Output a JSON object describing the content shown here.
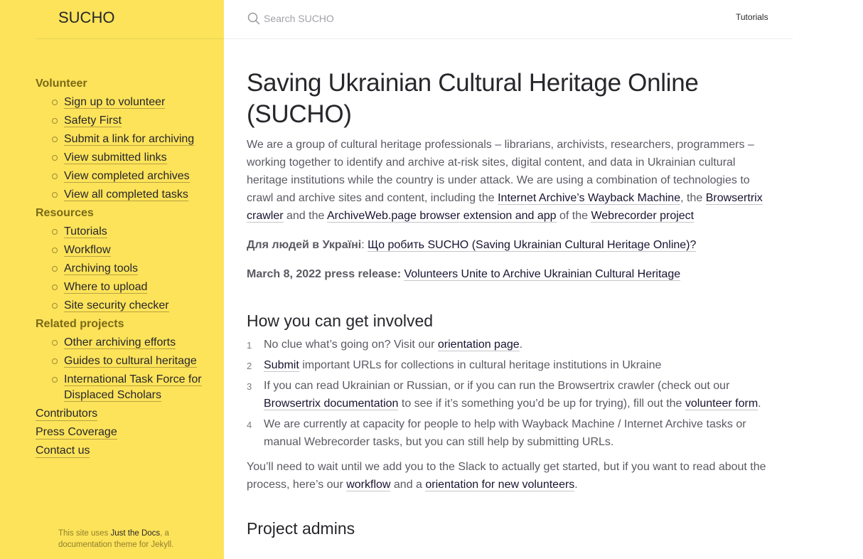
{
  "site": {
    "title": "SUCHO"
  },
  "search": {
    "placeholder": "Search SUCHO"
  },
  "topbar": {
    "link": "Tutorials"
  },
  "nav": {
    "volunteer": {
      "label": "Volunteer",
      "items": [
        "Sign up to volunteer",
        "Safety First",
        "Submit a link for archiving",
        "View submitted links",
        "View completed archives",
        "View all completed tasks"
      ]
    },
    "resources": {
      "label": "Resources",
      "items": [
        "Tutorials",
        "Workflow",
        "Archiving tools",
        "Where to upload",
        "Site security checker"
      ]
    },
    "related": {
      "label": "Related projects",
      "items": [
        "Other archiving efforts",
        "Guides to cultural heritage",
        "International Task Force for Displaced Scholars"
      ]
    },
    "top": [
      "Contributors",
      "Press Coverage",
      "Contact us"
    ]
  },
  "footer": {
    "prefix": "This site uses ",
    "link": "Just the Docs",
    "suffix": ", a documentation theme for Jekyll."
  },
  "main": {
    "title": "Saving Ukrainian Cultural Heritage Online (SUCHO)",
    "intro": {
      "text1": "We are a group of cultural heritage professionals – librarians, archivists, researchers, programmers – working together to identify and archive at-risk sites, digital content, and data in Ukrainian cultural heritage institutions while the country is under attack. We are using a combination of technologies to crawl and archive sites and content, including the ",
      "link1": "Internet Archive’s Wayback Machine",
      "text2": ", the ",
      "link2": "Browsertrix crawler",
      "text3": " and the ",
      "link3": "ArchiveWeb.page browser extension and app",
      "text4": " of the ",
      "link4": "Webrecorder project"
    },
    "ukraine": {
      "label": "Для людей в Україні",
      "sep": ": ",
      "link": "Що робить SUCHO (Saving Ukrainian Cultural Heritage Online)?"
    },
    "press": {
      "label": "March 8, 2022 press release:",
      "link": "Volunteers Unite to Archive Ukrainian Cultural Heritage"
    },
    "involved": {
      "heading": "How you can get involved",
      "items": [
        {
          "num": "1",
          "text1": "No clue what’s going on? Visit our ",
          "link1": "orientation page",
          "text2": "."
        },
        {
          "num": "2",
          "link1": "Submit",
          "text1": " important URLs for collections in cultural heritage institutions in Ukraine"
        },
        {
          "num": "3",
          "text1": "If you can read Ukrainian or Russian, or if you can run the Browsertrix crawler (check out our ",
          "link1": "Browsertrix documentation",
          "text2": " to see if it’s something you’d be up for trying), fill out the ",
          "link2": "volunteer form",
          "text3": "."
        },
        {
          "num": "4",
          "text1": "We are currently at capacity for people to help with Wayback Machine / Internet Archive tasks or manual Webrecorder tasks, but you can still help by submitting URLs."
        }
      ]
    },
    "wait": {
      "text1": "You’ll need to wait until we add you to the Slack to actually get started, but if you want to read about the process, here’s our ",
      "link1": "workflow",
      "text2": " and a ",
      "link2": "orientation for new volunteers",
      "text3": "."
    },
    "admins_heading": "Project admins"
  }
}
